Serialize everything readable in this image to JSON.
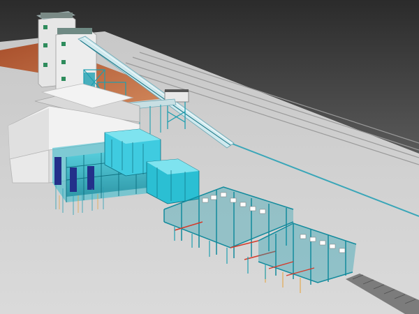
{
  "scene": {
    "kind": "3d-render",
    "palette": {
      "sky_top": "#2e2e2e",
      "sky_bottom": "#8c8c8c",
      "ground": "#d2d2d2",
      "earth": "#b7623b",
      "building": "#e8e8e8",
      "building_shade": "#bdbdbd",
      "steel": "#1e9fb0",
      "steel_dark": "#0d6f7f",
      "equipment": "#23b7c9",
      "equipment_dark": "#157f93",
      "navy": "#23308a",
      "accent_red": "#d43a2a",
      "accent_orange": "#e7a13a",
      "conveyor_dark": "#6d6d6d"
    }
  }
}
